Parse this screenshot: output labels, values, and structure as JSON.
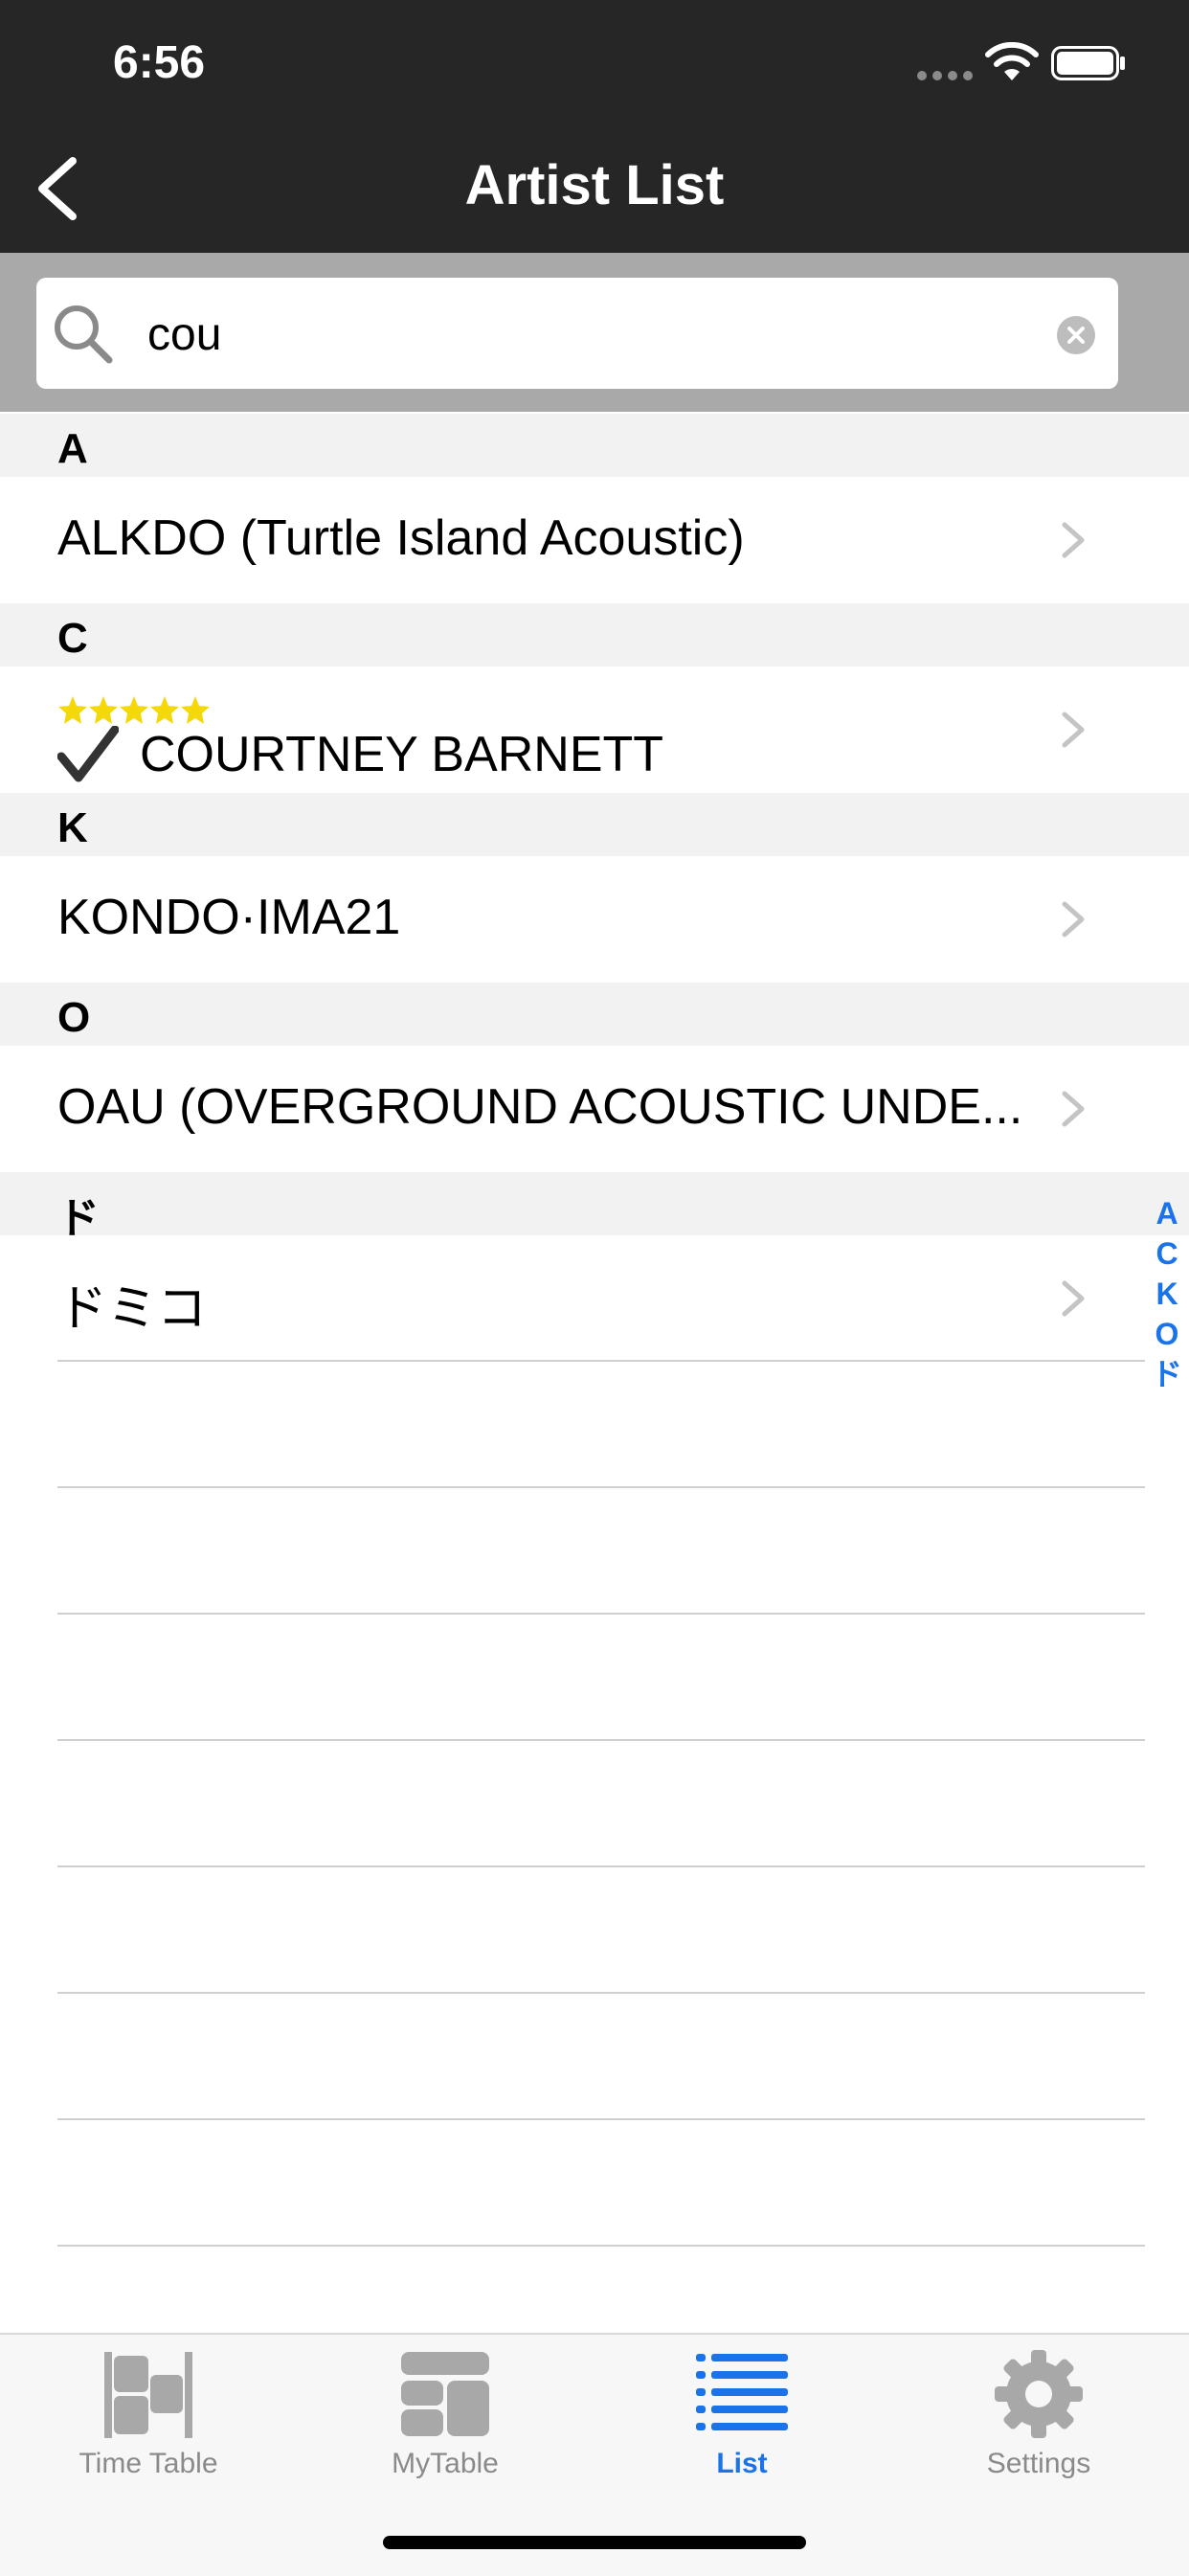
{
  "status": {
    "time": "6:56"
  },
  "header": {
    "title": "Artist List"
  },
  "search": {
    "value": "cou"
  },
  "sections": [
    {
      "letter": "A",
      "items": [
        {
          "name": "ALKDO (Turtle Island Acoustic)"
        }
      ]
    },
    {
      "letter": "C",
      "items": [
        {
          "name": "COURTNEY BARNETT",
          "rating": 5,
          "checked": true
        }
      ]
    },
    {
      "letter": "K",
      "items": [
        {
          "name": "KONDO·IMA21"
        }
      ]
    },
    {
      "letter": "O",
      "items": [
        {
          "name": "OAU (OVERGROUND ACOUSTIC UNDE..."
        }
      ]
    },
    {
      "letter": "ド",
      "items": [
        {
          "name": "ドミコ"
        }
      ]
    }
  ],
  "index": [
    "A",
    "C",
    "K",
    "O",
    "ド"
  ],
  "tabs": [
    {
      "label": "Time Table",
      "icon": "timetable-icon",
      "active": false
    },
    {
      "label": "MyTable",
      "icon": "mytable-icon",
      "active": false
    },
    {
      "label": "List",
      "icon": "list-icon",
      "active": true
    },
    {
      "label": "Settings",
      "icon": "gear-icon",
      "active": false
    }
  ],
  "colors": {
    "accent": "#1a73e8",
    "header_bg": "#262626",
    "star": "#f5d80a"
  }
}
